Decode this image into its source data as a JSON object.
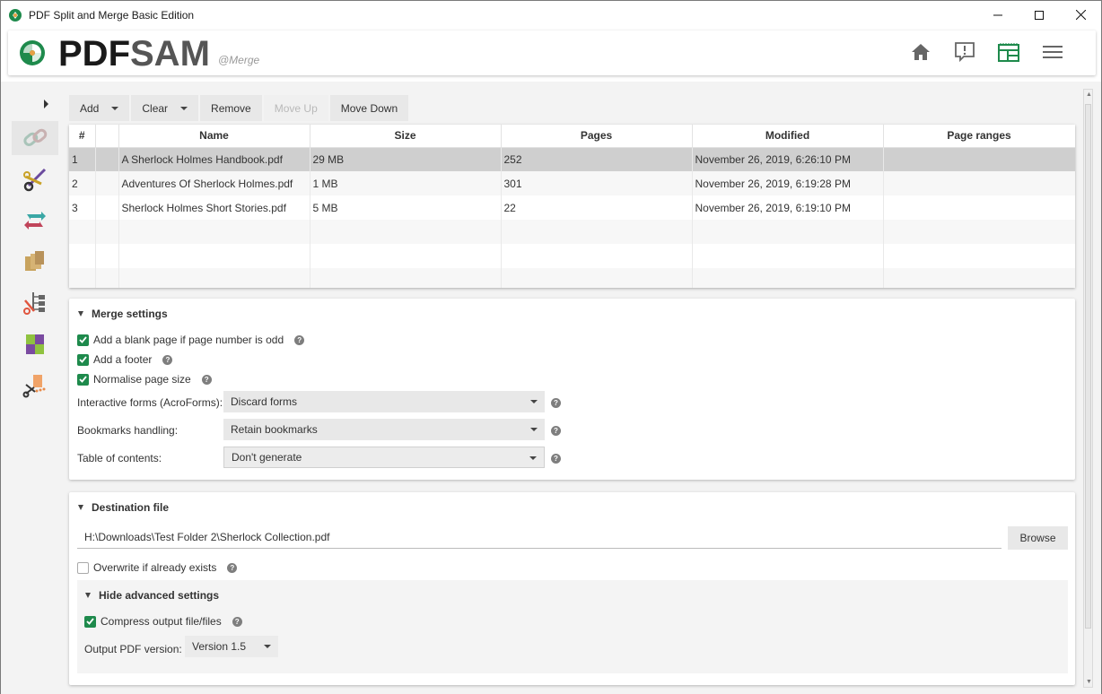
{
  "window": {
    "title": "PDF Split and Merge Basic Edition",
    "controls": [
      "minimize",
      "maximize",
      "close"
    ]
  },
  "header": {
    "logo_pdf": "PDF",
    "logo_sam": "SAM",
    "module_label": "@Merge",
    "icons": [
      "home-icon",
      "feedback-icon",
      "dashboard-icon",
      "menu-icon"
    ],
    "accent_color": "#1e8a4c"
  },
  "sidebar": {
    "items": [
      {
        "name": "merge",
        "active": true
      },
      {
        "name": "split"
      },
      {
        "name": "rotate"
      },
      {
        "name": "extract"
      },
      {
        "name": "split-by-bookmarks"
      },
      {
        "name": "alternate-mix"
      },
      {
        "name": "split-by-size"
      }
    ]
  },
  "toolbar": {
    "add": "Add",
    "clear": "Clear",
    "remove": "Remove",
    "move_up": "Move Up",
    "move_down": "Move Down"
  },
  "table": {
    "columns": [
      "#",
      "",
      "Name",
      "Size",
      "Pages",
      "Modified",
      "Page ranges"
    ],
    "rows": [
      {
        "num": "1",
        "name": "A Sherlock Holmes Handbook.pdf",
        "size": "29 MB",
        "pages": "252",
        "modified": "November 26, 2019, 6:26:10 PM",
        "ranges": "",
        "selected": true
      },
      {
        "num": "2",
        "name": "Adventures Of Sherlock Holmes.pdf",
        "size": "1 MB",
        "pages": "301",
        "modified": "November 26, 2019, 6:19:28 PM",
        "ranges": ""
      },
      {
        "num": "3",
        "name": "Sherlock Holmes Short Stories.pdf",
        "size": "5 MB",
        "pages": "22",
        "modified": "November 26, 2019, 6:19:10 PM",
        "ranges": ""
      }
    ]
  },
  "merge_settings": {
    "title": "Merge settings",
    "blank_page": {
      "label": "Add a blank page if page number is odd",
      "checked": true
    },
    "footer": {
      "label": "Add a footer",
      "checked": true
    },
    "normalise": {
      "label": "Normalise page size",
      "checked": true
    },
    "forms": {
      "label": "Interactive forms (AcroForms):",
      "value": "Discard forms"
    },
    "bookmarks": {
      "label": "Bookmarks handling:",
      "value": "Retain bookmarks"
    },
    "toc": {
      "label": "Table of contents:",
      "value": "Don't generate"
    }
  },
  "destination": {
    "title": "Destination file",
    "path": "H:\\Downloads\\Test Folder 2\\Sherlock Collection.pdf",
    "browse": "Browse",
    "overwrite": {
      "label": "Overwrite if already exists",
      "checked": false
    },
    "advanced_title": "Hide advanced settings",
    "compress": {
      "label": "Compress output file/files",
      "checked": true
    },
    "pdf_version_label": "Output PDF version:",
    "pdf_version": "Version 1.5"
  },
  "help_glyph": "?"
}
